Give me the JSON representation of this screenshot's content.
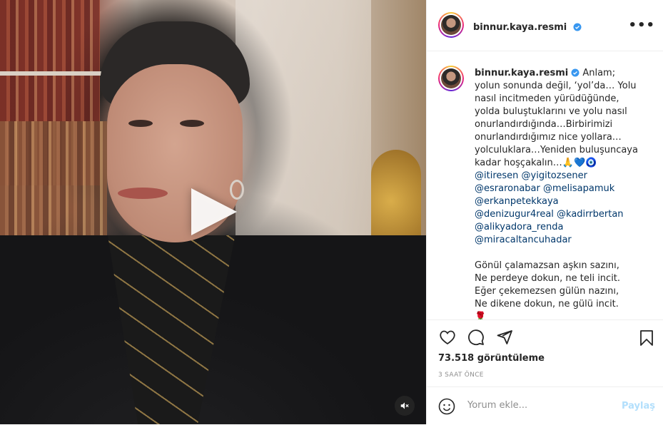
{
  "post": {
    "username": "binnur.kaya.resmi",
    "verified": true,
    "more_label": "•••"
  },
  "caption": {
    "username": "binnur.kaya.resmi",
    "text": "Anlam; yolun sonunda değil, ‘yol’da… Yolu nasıl incitmeden yürüdüğünde, yolda buluştuklarını ve yolu nasıl onurlandırdığında…Birbirimizi onurlandırdığımız nice yollara… yolculuklara…Yeniden buluşuncaya kadar hoşçakalın…🙏💙🧿",
    "tags": [
      "@itiresen @yigitozsener",
      "@esraronabar @melisapamuk",
      "@erkanpetekkaya",
      "@denizugur4real @kadirrbertan",
      "@alikyadora_renda",
      "@miracaltancuhadar"
    ],
    "poem": "Gönül çalamazsan aşkın sazını,\nNe perdeye dokun, ne teli incit.\nEğer çekemezsen gülün nazını,\nNe dikene dokun, ne gülü incit.\n🌹"
  },
  "stats": {
    "views": "73.518 görüntüleme",
    "time_ago": "3 SAAT ÖNCE"
  },
  "comment": {
    "placeholder": "Yorum ekle...",
    "share_label": "Paylaş"
  },
  "colors": {
    "link": "#00376b",
    "verified": "#3897f0",
    "share_disabled": "#b2dffc"
  },
  "icons": [
    "play-icon",
    "mute-icon",
    "verified-icon",
    "more-icon",
    "heart-icon",
    "comment-icon",
    "share-icon",
    "bookmark-icon",
    "emoji-icon"
  ]
}
